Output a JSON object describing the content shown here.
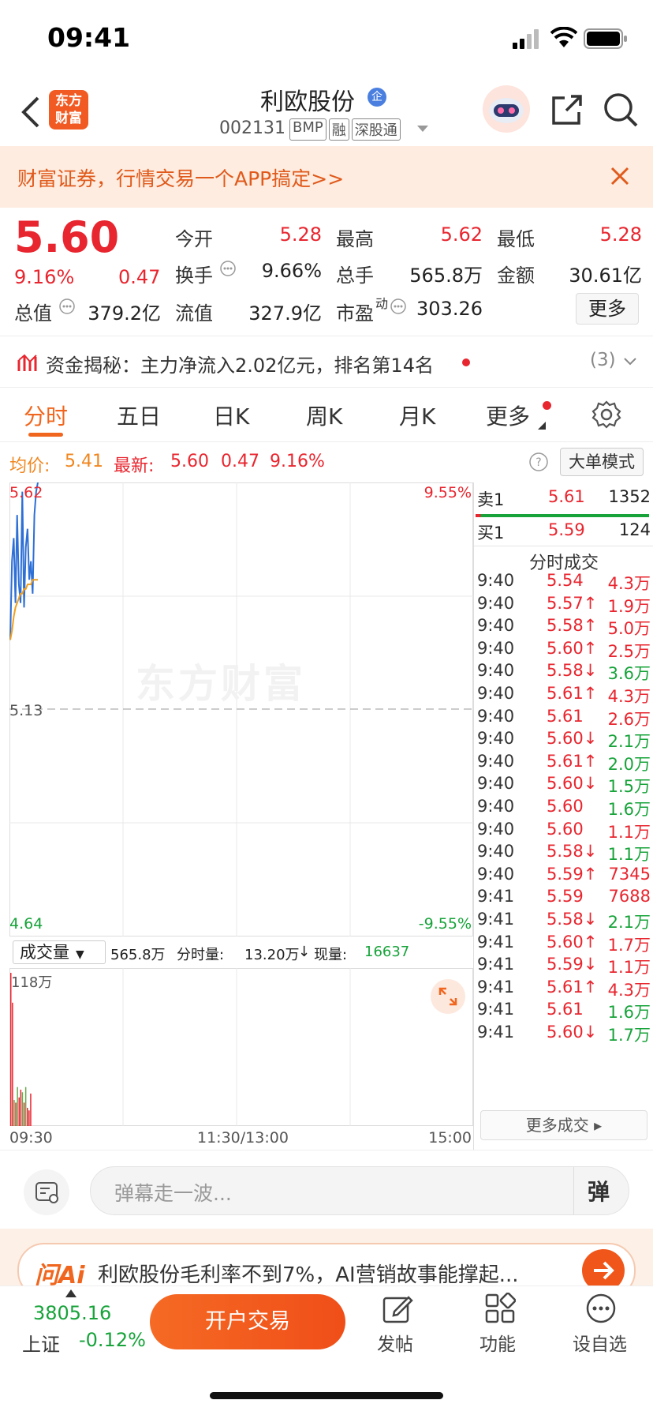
{
  "status": {
    "time": "09:41"
  },
  "header": {
    "brand_logo_line1": "东方",
    "brand_logo_line2": "财富",
    "stock_name": "利欧股份",
    "enterprise_badge": "企",
    "stock_code": "002131",
    "tags": [
      "BMP",
      "融",
      "深股通"
    ]
  },
  "banner": {
    "text": "财富证券，行情交易一个APP搞定>>"
  },
  "quote": {
    "price": "5.60",
    "change_pct": "9.16%",
    "change": "0.47",
    "open_label": "今开",
    "open": "5.28",
    "high_label": "最高",
    "high": "5.62",
    "low_label": "最低",
    "low": "5.28",
    "turnover_label": "换手",
    "turnover": "9.66%",
    "total_hands_label": "总手",
    "total_hands": "565.8万",
    "amount_label": "金额",
    "amount": "30.61亿",
    "mktcap_label": "总值",
    "mktcap": "379.2亿",
    "float_label": "流值",
    "float": "327.9亿",
    "pe_label": "市盈",
    "pe_sup": "动",
    "pe": "303.26",
    "more_button": "更多"
  },
  "fund_flow": {
    "text": "资金揭秘：主力净流入2.02亿元，排名第14名",
    "count": "(3)"
  },
  "tabs": [
    {
      "label": "分时",
      "active": true
    },
    {
      "label": "五日"
    },
    {
      "label": "日K"
    },
    {
      "label": "周K"
    },
    {
      "label": "月K"
    },
    {
      "label": "更多"
    }
  ],
  "avg_line": {
    "avg_label": "均价:",
    "avg": "5.41",
    "latest_label": "最新:",
    "latest": "5.60",
    "change": "0.47",
    "pct": "9.16%",
    "big_order_button": "大单模式"
  },
  "chart": {
    "top_left": "5.62",
    "top_right": "9.55%",
    "mid": "5.13",
    "bottom_left": "4.64",
    "bottom_right": "-9.55%",
    "watermark": "东方财富"
  },
  "chart_data": {
    "type": "line",
    "ylim": [
      4.64,
      5.62
    ],
    "x_ticks": [
      "09:30",
      "11:30/13:00",
      "15:00"
    ],
    "series": [
      {
        "values": [
          5.28,
          5.45,
          5.5,
          5.36,
          5.55,
          5.4,
          5.36,
          5.6,
          5.35,
          5.48,
          5.52,
          5.41,
          5.45,
          5.38,
          5.55,
          5.6,
          5.62
        ],
        "color": "#2e6fd6"
      },
      {
        "values": [
          5.28,
          5.3,
          5.33,
          5.35,
          5.36,
          5.37,
          5.38,
          5.38,
          5.39,
          5.39,
          5.4,
          5.4,
          5.4,
          5.41,
          5.41,
          5.41,
          5.41
        ],
        "color": "#f0a020"
      }
    ],
    "volume": {
      "ylabel": "118万",
      "values": [
        118,
        95,
        20,
        18,
        30,
        22,
        28,
        26,
        18,
        30,
        14,
        12,
        25
      ],
      "colors": [
        "r",
        "r",
        "g",
        "r",
        "g",
        "r",
        "r",
        "g",
        "r",
        "g",
        "r",
        "r",
        "r"
      ]
    }
  },
  "volume_bar": {
    "select": "成交量",
    "total": "565.8万",
    "fenshi_label": "分时量:",
    "fenshi": "13.20万",
    "arrow": "↓",
    "now_label": "现量:",
    "now": "16637"
  },
  "orderbook": {
    "sell": {
      "label": "卖1",
      "price": "5.61",
      "vol": "1352"
    },
    "buy": {
      "label": "买1",
      "price": "5.59",
      "vol": "124"
    },
    "title": "分时成交",
    "more": "更多成交",
    "trades": [
      {
        "t": "9:40",
        "p": "5.54",
        "d": "",
        "v": "4.3万",
        "c": "red"
      },
      {
        "t": "9:40",
        "p": "5.57",
        "d": "↑",
        "v": "1.9万",
        "c": "red"
      },
      {
        "t": "9:40",
        "p": "5.58",
        "d": "↑",
        "v": "5.0万",
        "c": "red"
      },
      {
        "t": "9:40",
        "p": "5.60",
        "d": "↑",
        "v": "2.5万",
        "c": "red"
      },
      {
        "t": "9:40",
        "p": "5.58",
        "d": "↓",
        "v": "3.6万",
        "c": "green"
      },
      {
        "t": "9:40",
        "p": "5.61",
        "d": "↑",
        "v": "4.3万",
        "c": "red"
      },
      {
        "t": "9:40",
        "p": "5.61",
        "d": "",
        "v": "2.6万",
        "c": "red"
      },
      {
        "t": "9:40",
        "p": "5.60",
        "d": "↓",
        "v": "2.1万",
        "c": "green"
      },
      {
        "t": "9:40",
        "p": "5.61",
        "d": "↑",
        "v": "2.0万",
        "c": "green"
      },
      {
        "t": "9:40",
        "p": "5.60",
        "d": "↓",
        "v": "1.5万",
        "c": "green"
      },
      {
        "t": "9:40",
        "p": "5.60",
        "d": "",
        "v": "1.6万",
        "c": "green"
      },
      {
        "t": "9:40",
        "p": "5.60",
        "d": "",
        "v": "1.1万",
        "c": "red"
      },
      {
        "t": "9:40",
        "p": "5.58",
        "d": "↓",
        "v": "1.1万",
        "c": "green"
      },
      {
        "t": "9:40",
        "p": "5.59",
        "d": "↑",
        "v": "7345",
        "c": "red"
      },
      {
        "t": "9:41",
        "p": "5.59",
        "d": "",
        "v": "7688",
        "c": "red"
      },
      {
        "t": "9:41",
        "p": "5.58",
        "d": "↓",
        "v": "2.1万",
        "c": "green"
      },
      {
        "t": "9:41",
        "p": "5.60",
        "d": "↑",
        "v": "1.7万",
        "c": "red"
      },
      {
        "t": "9:41",
        "p": "5.59",
        "d": "↓",
        "v": "1.1万",
        "c": "red"
      },
      {
        "t": "9:41",
        "p": "5.61",
        "d": "↑",
        "v": "4.3万",
        "c": "red"
      },
      {
        "t": "9:41",
        "p": "5.61",
        "d": "",
        "v": "1.6万",
        "c": "green"
      },
      {
        "t": "9:41",
        "p": "5.60",
        "d": "↓",
        "v": "1.7万",
        "c": "green"
      }
    ]
  },
  "comment": {
    "placeholder": "弹幕走一波...",
    "danmu_button": "弹"
  },
  "ai": {
    "logo": "问Ai",
    "text": "利欧股份毛利率不到7%，AI营销故事能撑起..."
  },
  "bottom": {
    "index_value": "3805.16",
    "index_name": "上证",
    "index_change": "-0.12%",
    "trade_button": "开户交易",
    "post": "发帖",
    "func": "功能",
    "watch": "设自选"
  },
  "colors": {
    "red": "#e8262f",
    "green": "#17a33a",
    "orange": "#f0861e",
    "tab_underline": "#f0661e"
  }
}
